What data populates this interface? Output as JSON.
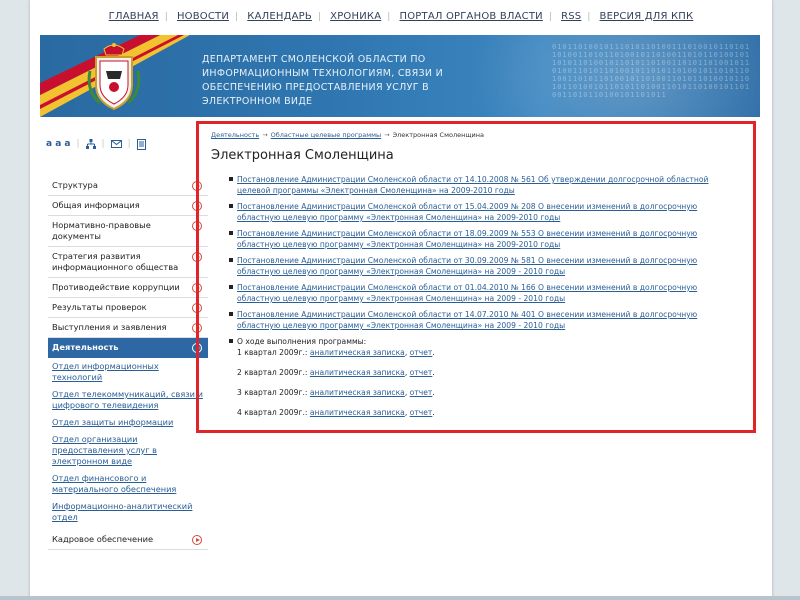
{
  "topnav": {
    "items": [
      "ГЛАВНАЯ",
      "НОВОСТИ",
      "КАЛЕНДАРЬ",
      "ХРОНИКА",
      "ПОРТАЛ ОРГАНОВ ВЛАСТИ",
      "RSS",
      "ВЕРСИЯ ДЛЯ КПК"
    ]
  },
  "banner": {
    "title": "ДЕПАРТАМЕНТ СМОЛЕНСКОЙ ОБЛАСТИ ПО ИНФОРМАЦИОННЫМ ТЕХНОЛОГИЯМ, СВЯЗИ И ОБЕСПЕЧЕНИЮ ПРЕДОСТАВЛЕНИЯ УСЛУГ В ЭЛЕКТРОННОМ ВИДЕ",
    "emblem_icon": "coat-of-arms-icon",
    "ribbon_colors": [
      "#c8102e",
      "#f2c230"
    ]
  },
  "tools": {
    "font_sizes": "a a a",
    "icons": [
      "sitemap-icon",
      "mail-icon",
      "print-icon"
    ]
  },
  "sidebar": {
    "items": [
      {
        "label": "Структура"
      },
      {
        "label": "Общая информация"
      },
      {
        "label": "Нормативно-правовые документы"
      },
      {
        "label": "Стратегия развития информационного общества"
      },
      {
        "label": "Противодействие коррупции"
      },
      {
        "label": "Результаты проверок"
      },
      {
        "label": "Выступления и заявления"
      },
      {
        "label": "Деятельность"
      }
    ],
    "subitems": [
      {
        "label": "Отдел информационных технологий"
      },
      {
        "label": "Отдел телекоммуникаций, связи и цифрового телевидения"
      },
      {
        "label": "Отдел защиты информации"
      },
      {
        "label": "Отдел организации предоставления услуг в электронном виде"
      },
      {
        "label": "Отдел финансового и материального обеспечения"
      },
      {
        "label": "Информационно-аналитический отдел"
      }
    ],
    "after": [
      {
        "label": "Кадровое обеспечение"
      }
    ]
  },
  "breadcrumb": {
    "items": [
      "Деятельность",
      "Областные целевые программы",
      "Электронная Смоленщина"
    ],
    "separator": "→"
  },
  "main": {
    "title": "Электронная Смоленщина",
    "documents": [
      {
        "text": "Постановление Администрации Смоленской области от 14.10.2008 № 561 Об утверждении долгосрочной областной целевой программы «Электронная Смоленщина» на 2009-2010 годы"
      },
      {
        "text": "Постановление Администрации Смоленской области от 15.04.2009 № 208 О внесении изменений в долгосрочную областную целевую программу «Электронная Смоленщина» на 2009-2010 годы"
      },
      {
        "text": "Постановление Администрации Смоленской области от 18.09.2009 № 553 О внесении изменений в долгосрочную областную целевую программу «Электронная Смоленщина» на 2009-2010 годы"
      },
      {
        "text": "Постановление Администрации Смоленской области от 30.09.2009 № 581 О внесении изменений в долгосрочную областную целевую программу «Электронная Смоленщина» на 2009 - 2010 годы"
      },
      {
        "text": "Постановление Администрации Смоленской области от 01.04.2010 № 166 О внесении изменений в долгосрочную областную целевую программу «Электронная Смоленщина» на 2009 - 2010 годы"
      },
      {
        "text": "Постановление Администрации Смоленской области от 14.07.2010 № 401 О внесении изменений в долгосрочную областную целевую программу «Электронная Смоленщина» на 2009 - 2010 годы"
      }
    ],
    "progress": {
      "heading": "О ходе выполнения программы:",
      "quarters": [
        {
          "label": "1 квартал 2009г.:",
          "note": "аналитическая записка",
          "comma": ",",
          "report": "отчет",
          "end": "."
        },
        {
          "label": "2 квартал 2009г.:",
          "note": "аналитическая записка",
          "comma": ",",
          "report": "отчет",
          "end": "."
        },
        {
          "label": "3 квартал 2009г.:",
          "note": "аналитическая записка",
          "comma": ",",
          "report": "отчет",
          "end": "."
        },
        {
          "label": "4 квартал 2009г.:",
          "note": "аналитическая записка",
          "comma": ",",
          "report": "отчет",
          "end": "."
        }
      ]
    }
  },
  "colors": {
    "accent_blue": "#2d67a4",
    "link": "#2a5e96",
    "highlight_border": "#e0242a",
    "arrow_red": "#d44b3c"
  }
}
